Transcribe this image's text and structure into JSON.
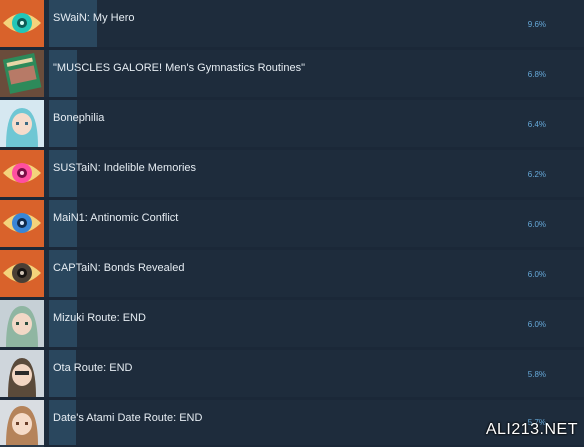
{
  "achievements": [
    {
      "name": "SWaiN: My Hero",
      "percent": "9.6%",
      "fill": 0.096,
      "icon": "eye-icon",
      "iris_color": "#23c6b8"
    },
    {
      "name": "\"MUSCLES GALORE! Men's Gymnastics Routines\"",
      "percent": "6.8%",
      "fill": 0.068,
      "icon": "book-icon",
      "iris_color": "#2d8a5a"
    },
    {
      "name": "Bonephilia",
      "percent": "6.4%",
      "fill": 0.064,
      "icon": "character-portrait-icon",
      "iris_color": "#6fc7d4"
    },
    {
      "name": "SUSTaiN: Indelible Memories",
      "percent": "6.2%",
      "fill": 0.062,
      "icon": "eye-icon",
      "iris_color": "#ff4fa0"
    },
    {
      "name": "MaiN1: Antinomic Conflict",
      "percent": "6.0%",
      "fill": 0.06,
      "icon": "eye-icon",
      "iris_color": "#3a86d6"
    },
    {
      "name": "CAPTaiN: Bonds Revealed",
      "percent": "6.0%",
      "fill": 0.06,
      "icon": "eye-icon",
      "iris_color": "#4a3f35"
    },
    {
      "name": "Mizuki Route: END",
      "percent": "6.0%",
      "fill": 0.06,
      "icon": "character-portrait-icon",
      "iris_color": "#8fb6a2"
    },
    {
      "name": "Ota Route: END",
      "percent": "5.8%",
      "fill": 0.058,
      "icon": "character-portrait-icon",
      "iris_color": "#5a4a3a"
    },
    {
      "name": "Date's Atami Date Route: END",
      "percent": "5.7%",
      "fill": 0.057,
      "icon": "character-portrait-icon",
      "iris_color": "#b5835a"
    }
  ],
  "watermark": "ALI213.NET",
  "colors": {
    "background": "#1b2838",
    "row": "#1e2c3c",
    "bar": "#2a475e",
    "percent_text": "#66a9d9",
    "title_text": "#e6edf3"
  }
}
